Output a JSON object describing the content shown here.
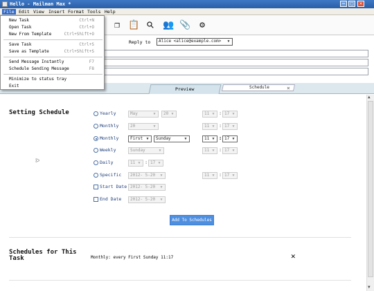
{
  "window": {
    "title": "Hello - Mailman Max *",
    "buttons": [
      "–",
      "□",
      "✕"
    ]
  },
  "menu": {
    "items": [
      "File",
      "Edit",
      "View",
      "Insert",
      "Format",
      "Tools",
      "Help"
    ]
  },
  "file_menu": {
    "items": [
      {
        "label": "New Task",
        "shortcut": "Ctrl+N"
      },
      {
        "label": "Open Task",
        "shortcut": "Ctrl+O"
      },
      {
        "label": "New From Template",
        "shortcut": "Ctrl+Shift+O"
      },
      {
        "label": "Save Task",
        "shortcut": "Ctrl+S"
      },
      {
        "label": "Save as Template",
        "shortcut": "Ctrl+Shift+S"
      },
      {
        "label": "Send Message Instantly",
        "shortcut": "F7"
      },
      {
        "label": "Schedule Sending Message",
        "shortcut": "F8"
      },
      {
        "label": "Minimize to status tray",
        "shortcut": ""
      },
      {
        "label": "Exit",
        "shortcut": ""
      }
    ]
  },
  "toolbar": {
    "icons": [
      "copy-icon",
      "paste-icon",
      "search-icon",
      "users-icon",
      "attachment-icon",
      "gear-icon"
    ],
    "glyphs": [
      "❐",
      "📋",
      "⚲",
      "👥",
      "📎",
      "⚙"
    ]
  },
  "header": {
    "reply_to_label": "Reply to",
    "reply_to_value": "Alice <alice@example.com>"
  },
  "tabs": {
    "preview": "Preview",
    "schedule": "Schedule",
    "close": "×"
  },
  "schedule": {
    "heading": "Setting Schedule",
    "rows": [
      {
        "label": "Yearly",
        "kind": "radio",
        "selected": false,
        "a": "May",
        "b": "20",
        "h": "11",
        "m": "17"
      },
      {
        "label": "Monthly",
        "kind": "radio",
        "selected": false,
        "a": "20",
        "h": "11",
        "m": "17"
      },
      {
        "label": "Monthly",
        "kind": "radio",
        "selected": true,
        "a": "First",
        "b": "Sunday",
        "h": "11",
        "m": "17"
      },
      {
        "label": "Weekly",
        "kind": "radio",
        "selected": false,
        "a": "Sunday",
        "h": "11",
        "m": "17"
      },
      {
        "label": "Daily",
        "kind": "radio",
        "selected": false,
        "h": "11",
        "m": "17"
      },
      {
        "label": "Specific",
        "kind": "radio",
        "selected": false,
        "a": "2012- 5-20",
        "h": "11",
        "m": "17"
      },
      {
        "label": "Start Date",
        "kind": "check",
        "selected": false,
        "a": "2012- 5-20"
      },
      {
        "label": "End Date",
        "kind": "check",
        "selected": false,
        "a": "2012- 5-20"
      }
    ],
    "add_button": "Add To Schedules"
  },
  "schedules_list": {
    "heading": "Schedules for This Task",
    "entry": "Monthly: every First Sunday 11:17",
    "remove": "✕"
  },
  "colors": {
    "title_bar": "#2f67b5",
    "accent_button": "#4f8fe0",
    "label_blue": "#1c3c78"
  }
}
